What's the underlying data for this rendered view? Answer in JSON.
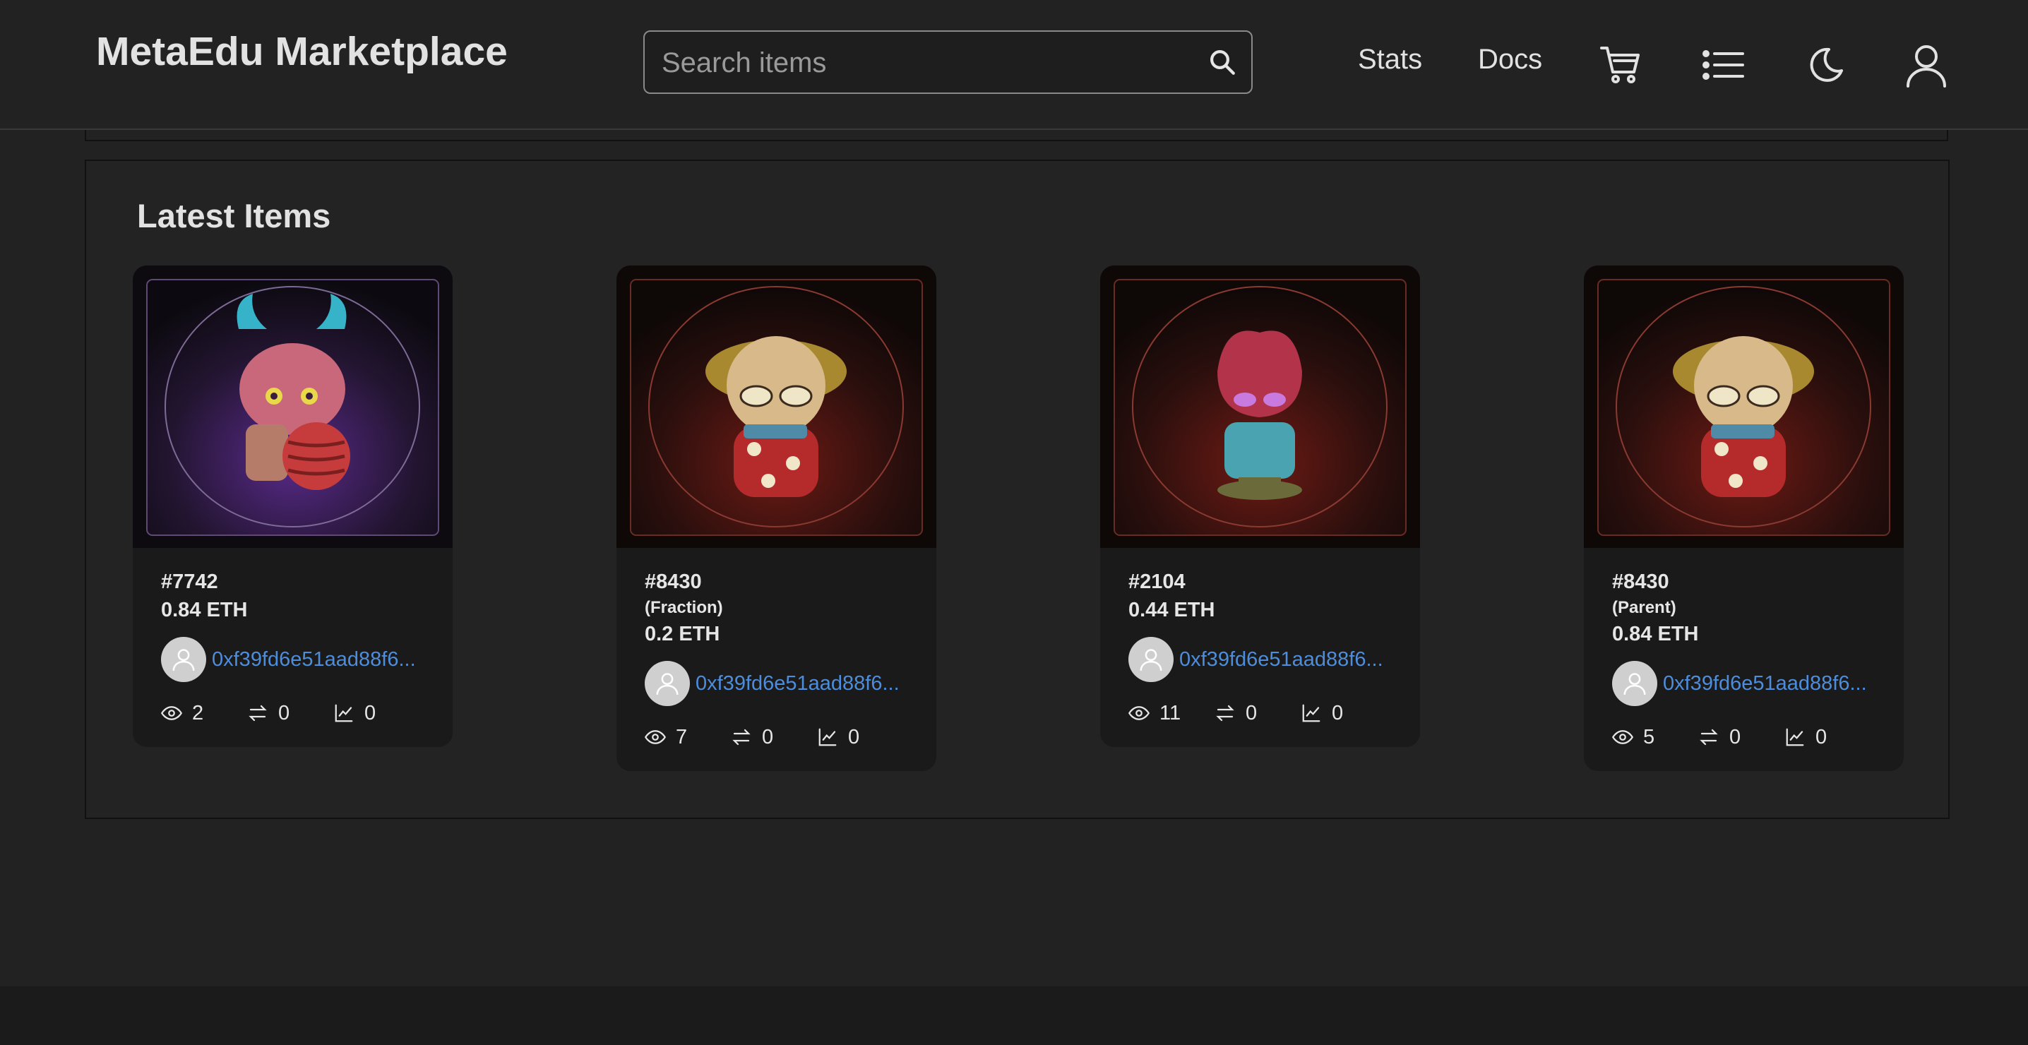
{
  "header": {
    "brand": "MetaEdu Marketplace",
    "search_placeholder": "Search items",
    "nav": {
      "stats": "Stats",
      "docs": "Docs"
    },
    "icons": [
      "search-icon",
      "cart-icon",
      "list-icon",
      "moon-icon",
      "user-icon"
    ]
  },
  "latest": {
    "title": "Latest Items",
    "items": [
      {
        "token": "#7742",
        "tag": "",
        "price": "0.84 ETH",
        "owner": "0xf39fd6e51aad88f6...",
        "views": "2",
        "transfers": "0",
        "sales": "0",
        "bg": "purple"
      },
      {
        "token": "#8430",
        "tag": "(Fraction)",
        "price": "0.2 ETH",
        "owner": "0xf39fd6e51aad88f6...",
        "views": "7",
        "transfers": "0",
        "sales": "0",
        "bg": "red"
      },
      {
        "token": "#2104",
        "tag": "",
        "price": "0.44 ETH",
        "owner": "0xf39fd6e51aad88f6...",
        "views": "11",
        "transfers": "0",
        "sales": "0",
        "bg": "red"
      },
      {
        "token": "#8430",
        "tag": "(Parent)",
        "price": "0.84 ETH",
        "owner": "0xf39fd6e51aad88f6...",
        "views": "5",
        "transfers": "0",
        "sales": "0",
        "bg": "red"
      }
    ]
  },
  "colors": {
    "background": "#222222",
    "card": "#1a1a1a",
    "link": "#4d8ddb",
    "footer": "#1b1b1b"
  }
}
